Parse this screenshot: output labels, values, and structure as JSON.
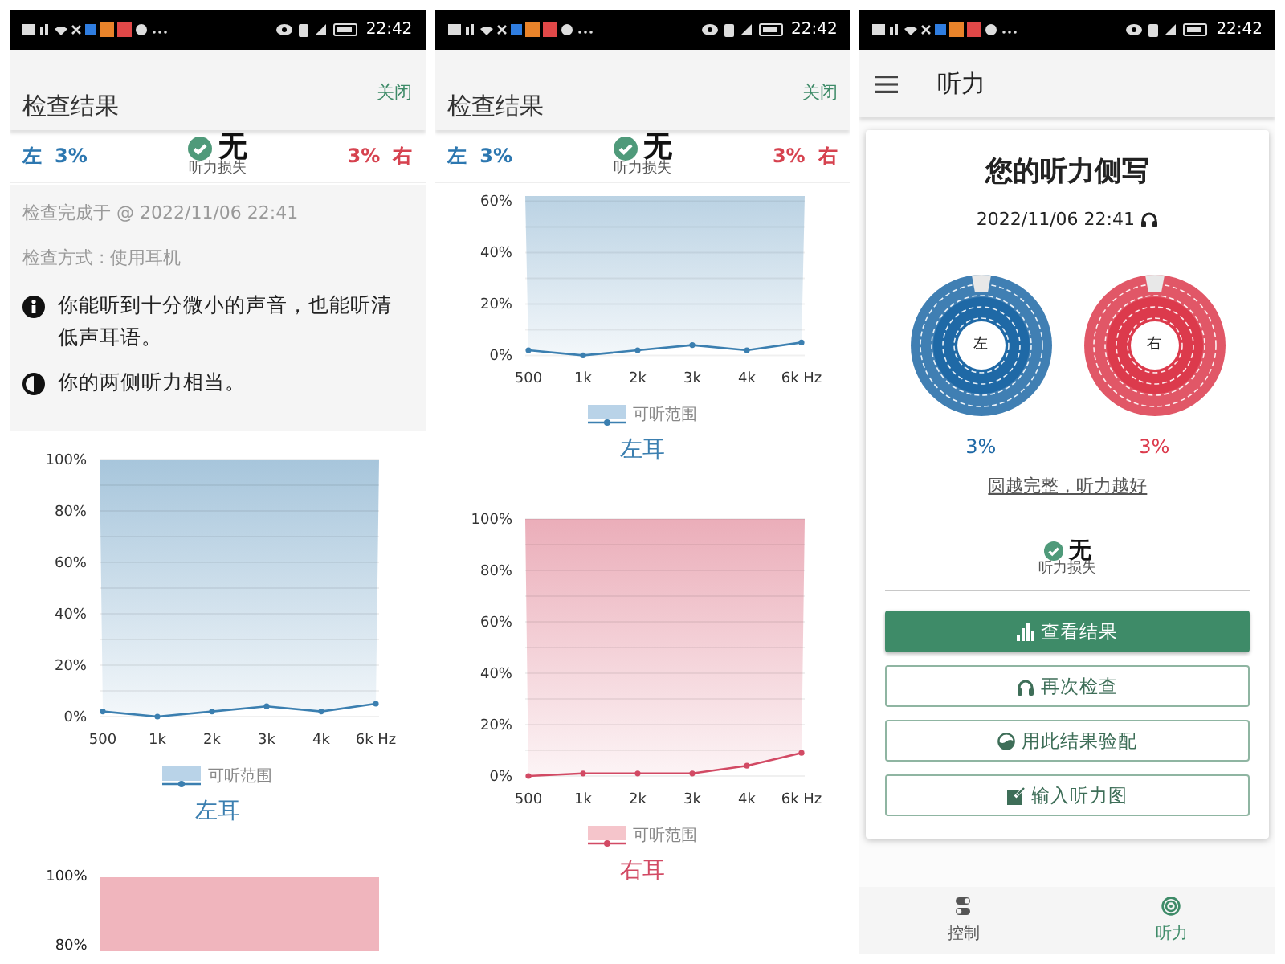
{
  "screens": [
    {
      "kind": "results",
      "status_bar": {
        "time": "22:42"
      },
      "header": {
        "title": "检查结果",
        "action": "关闭"
      },
      "summary": {
        "left_label": "左",
        "left_value": "3%",
        "result": "无",
        "result_caption": "听力损失",
        "right_value": "3%",
        "right_label": "右"
      },
      "info": {
        "lines": [
          "检查完成于 @ 2022/11/06 22:41",
          "检查方式 : 使用耳机"
        ],
        "notes": [
          "你能听到十分微小的声音，也能听清低声耳语。",
          "你的两侧听力相当。"
        ]
      },
      "charts": [
        {
          "color": "#b9d3e8",
          "caption": "左耳",
          "chart_data": {
            "type": "line",
            "grid": true,
            "categories": [
              "500",
              "1k",
              "2k",
              "3k",
              "4k",
              "6k Hz"
            ],
            "ylim": [
              0,
              100
            ],
            "yticks": [
              {
                "value": 0,
                "label": "0%"
              },
              {
                "value": 20,
                "label": "20%"
              },
              {
                "value": 40,
                "label": "40%"
              },
              {
                "value": 60,
                "label": "60%"
              },
              {
                "value": 80,
                "label": "80%"
              },
              {
                "value": 100,
                "label": "100%"
              }
            ],
            "series": [
              {
                "name": "可听范围",
                "color": "#3b7fb0",
                "marker": true,
                "values": [
                  2,
                  0,
                  2,
                  4,
                  2,
                  5
                ]
              }
            ]
          }
        },
        {
          "color": "#f0b5bd",
          "axis_labels": [
            "100%",
            "80%"
          ]
        }
      ]
    },
    {
      "kind": "results",
      "status_bar": {
        "time": "22:42"
      },
      "header": {
        "title": "检查结果",
        "action": "关闭"
      },
      "summary": {
        "left_label": "左",
        "left_value": "3%",
        "result": "无",
        "result_caption": "听力损失",
        "right_value": "3%",
        "right_label": "右"
      },
      "charts": [
        {
          "color": "#b9d3e8",
          "caption": "左耳",
          "chart_data": {
            "type": "line",
            "grid": true,
            "categories": [
              "500",
              "1k",
              "2k",
              "3k",
              "4k",
              "6k Hz"
            ],
            "ylim": [
              0,
              62
            ],
            "yticks": [
              {
                "value": 0,
                "label": "0%"
              },
              {
                "value": 20,
                "label": "20%"
              },
              {
                "value": 40,
                "label": "40%"
              },
              {
                "value": 60,
                "label": "60%"
              }
            ],
            "series": [
              {
                "name": "可听范围",
                "color": "#3b7fb0",
                "marker": true,
                "values": [
                  2,
                  0,
                  2,
                  4,
                  2,
                  5
                ]
              }
            ]
          }
        },
        {
          "color": "#f5c5cb",
          "caption": "右耳",
          "chart_data": {
            "type": "line",
            "grid": true,
            "categories": [
              "500",
              "1k",
              "2k",
              "3k",
              "4k",
              "6k Hz"
            ],
            "ylim": [
              0,
              100
            ],
            "yticks": [
              {
                "value": 0,
                "label": "0%"
              },
              {
                "value": 20,
                "label": "20%"
              },
              {
                "value": 40,
                "label": "40%"
              },
              {
                "value": 60,
                "label": "60%"
              },
              {
                "value": 80,
                "label": "80%"
              },
              {
                "value": 100,
                "label": "100%"
              }
            ],
            "series": [
              {
                "name": "可听范围",
                "color": "#d24a64",
                "marker": true,
                "values": [
                  0,
                  1,
                  1,
                  1,
                  4,
                  9
                ]
              }
            ]
          }
        }
      ]
    },
    {
      "kind": "profile",
      "status_bar": {
        "time": "22:42"
      },
      "app_bar": {
        "title": "听力"
      },
      "card": {
        "title": "您的听力侧写",
        "date": "2022/11/06 22:41",
        "rings": [
          {
            "label": "左",
            "value": "3%",
            "color": "#1f69a6"
          },
          {
            "label": "右",
            "value": "3%",
            "color": "#dc3a4c"
          }
        ],
        "hint": "圆越完整，听力越好",
        "result": "无",
        "result_caption": "听力损失",
        "buttons": [
          {
            "label": "查看结果",
            "kind": "primary"
          },
          {
            "label": "再次检查",
            "kind": "outline"
          },
          {
            "label": "用此结果验配",
            "kind": "outline"
          },
          {
            "label": "输入听力图",
            "kind": "outline"
          }
        ]
      },
      "bottom_nav": [
        {
          "label": "控制",
          "selected": false
        },
        {
          "label": "听力",
          "selected": true
        }
      ]
    }
  ]
}
